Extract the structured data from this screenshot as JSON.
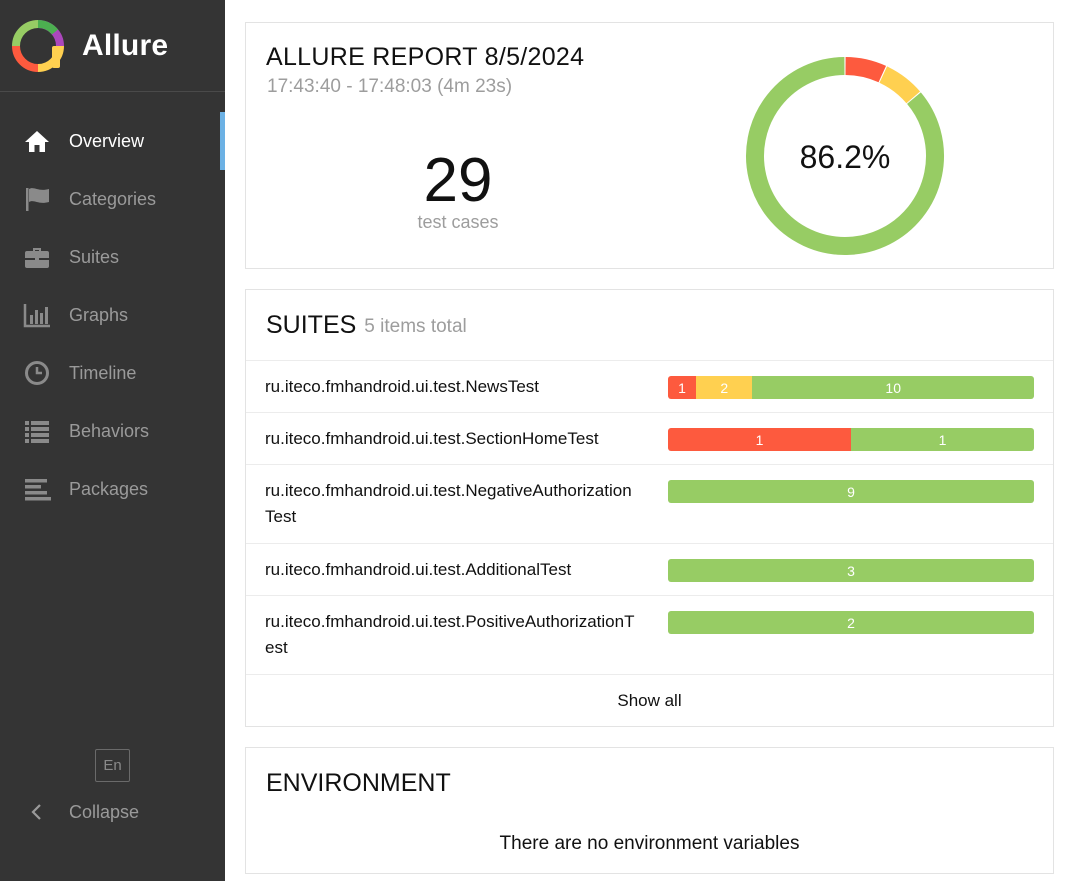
{
  "brand": {
    "name": "Allure"
  },
  "nav": {
    "items": [
      {
        "label": "Overview",
        "icon": "home-icon"
      },
      {
        "label": "Categories",
        "icon": "flag-icon"
      },
      {
        "label": "Suites",
        "icon": "briefcase-icon"
      },
      {
        "label": "Graphs",
        "icon": "bar-chart-icon"
      },
      {
        "label": "Timeline",
        "icon": "clock-icon"
      },
      {
        "label": "Behaviors",
        "icon": "list-icon"
      },
      {
        "label": "Packages",
        "icon": "align-left-icon"
      }
    ],
    "active": "Overview"
  },
  "footer": {
    "lang": "En",
    "collapse_label": "Collapse"
  },
  "summary": {
    "title": "ALLURE REPORT 8/5/2024",
    "time": "17:43:40 - 17:48:03 (4m 23s)",
    "count": "29",
    "count_label": "test cases",
    "percent": "86.2%",
    "donut": {
      "failed": 2,
      "broken": 2,
      "passed": 25
    }
  },
  "suites": {
    "title": "SUITES",
    "count_text": "5 items total",
    "rows": [
      {
        "name": "ru.iteco.fmhandroid.ui.test.NewsTest",
        "segments": [
          {
            "status": "failed",
            "value": 1
          },
          {
            "status": "broken",
            "value": 2
          },
          {
            "status": "passed",
            "value": 10
          }
        ]
      },
      {
        "name": "ru.iteco.fmhandroid.ui.test.SectionHomeTest",
        "segments": [
          {
            "status": "failed",
            "value": 1
          },
          {
            "status": "passed",
            "value": 1
          }
        ]
      },
      {
        "name": "ru.iteco.fmhandroid.ui.test.NegativeAuthorizationTest",
        "segments": [
          {
            "status": "passed",
            "value": 9
          }
        ]
      },
      {
        "name": "ru.iteco.fmhandroid.ui.test.AdditionalTest",
        "segments": [
          {
            "status": "passed",
            "value": 3
          }
        ]
      },
      {
        "name": "ru.iteco.fmhandroid.ui.test.PositiveAuthorizationTest",
        "segments": [
          {
            "status": "passed",
            "value": 2
          }
        ]
      }
    ],
    "show_all": "Show all"
  },
  "environment": {
    "title": "ENVIRONMENT",
    "empty_text": "There are no environment variables"
  },
  "colors": {
    "sidebar": "#343434",
    "active_indicator": "#6cb1e4",
    "failed": "#fd5a3e",
    "broken": "#ffd050",
    "passed": "#97cc64"
  }
}
